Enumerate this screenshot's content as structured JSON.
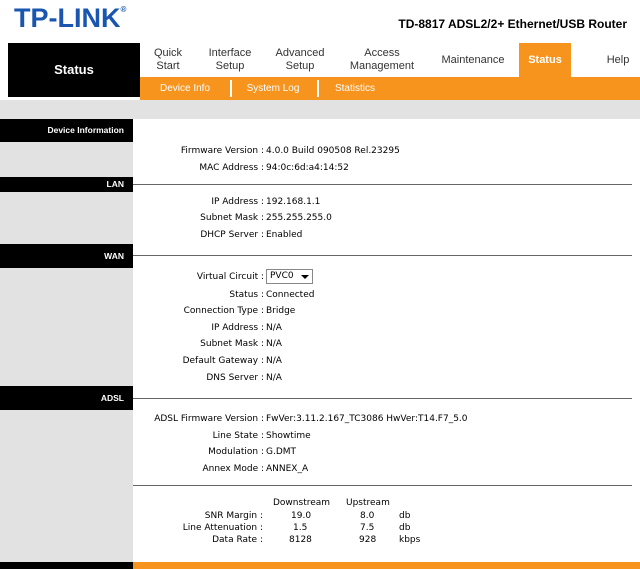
{
  "header": {
    "logo_text": "TP-LINK",
    "logo_registered": "®",
    "model": "TD-8817 ADSL2/2+ Ethernet/USB Router"
  },
  "nav": {
    "section_title": "Status",
    "items": [
      {
        "line1": "Quick",
        "line2": "Start"
      },
      {
        "line1": "Interface",
        "line2": "Setup"
      },
      {
        "line1": "Advanced",
        "line2": "Setup"
      },
      {
        "line1": "Access",
        "line2": "Management"
      },
      {
        "line1": "Maintenance",
        "line2": ""
      },
      {
        "line1": "Status",
        "line2": ""
      },
      {
        "line1": "Help",
        "line2": ""
      }
    ],
    "active": "Status"
  },
  "subnav": {
    "items": [
      "Device Info",
      "System Log",
      "Statistics"
    ]
  },
  "sections": {
    "device_info": "Device Information",
    "lan": "LAN",
    "wan": "WAN",
    "adsl": "ADSL"
  },
  "device": {
    "firmware_label": "Firmware Version :",
    "firmware_value": "4.0.0 Build 090508 Rel.23295",
    "mac_label": "MAC Address :",
    "mac_value": "94:0c:6d:a4:14:52"
  },
  "lan": {
    "ip_label": "IP Address :",
    "ip_value": "192.168.1.1",
    "mask_label": "Subnet Mask :",
    "mask_value": "255.255.255.0",
    "dhcp_label": "DHCP Server :",
    "dhcp_value": "Enabled"
  },
  "wan": {
    "vc_label": "Virtual Circuit :",
    "vc_value": "PVC0",
    "status_label": "Status :",
    "status_value": "Connected",
    "conn_label": "Connection Type :",
    "conn_value": "Bridge",
    "ip_label": "IP Address :",
    "ip_value": "N/A",
    "mask_label": "Subnet Mask :",
    "mask_value": "N/A",
    "gw_label": "Default Gateway :",
    "gw_value": "N/A",
    "dns_label": "DNS Server :",
    "dns_value": "N/A"
  },
  "adsl": {
    "fw_label": "ADSL Firmware Version :",
    "fw_value": "FwVer:3.11.2.167_TC3086 HwVer:T14.F7_5.0",
    "line_label": "Line State :",
    "line_value": "Showtime",
    "mod_label": "Modulation :",
    "mod_value": "G.DMT",
    "annex_label": "Annex Mode :",
    "annex_value": "ANNEX_A",
    "stats": {
      "col_down": "Downstream",
      "col_up": "Upstream",
      "rows": [
        {
          "label": "SNR Margin :",
          "down": "19.0",
          "up": "8.0",
          "unit": "db"
        },
        {
          "label": "Line Attenuation :",
          "down": "1.5",
          "up": "7.5",
          "unit": "db"
        },
        {
          "label": "Data Rate :",
          "down": "8128",
          "up": "928",
          "unit": "kbps"
        }
      ]
    }
  },
  "colors": {
    "accent": "#f7941e",
    "logo": "#1a56b0",
    "sidebar": "#e2e2e2"
  }
}
